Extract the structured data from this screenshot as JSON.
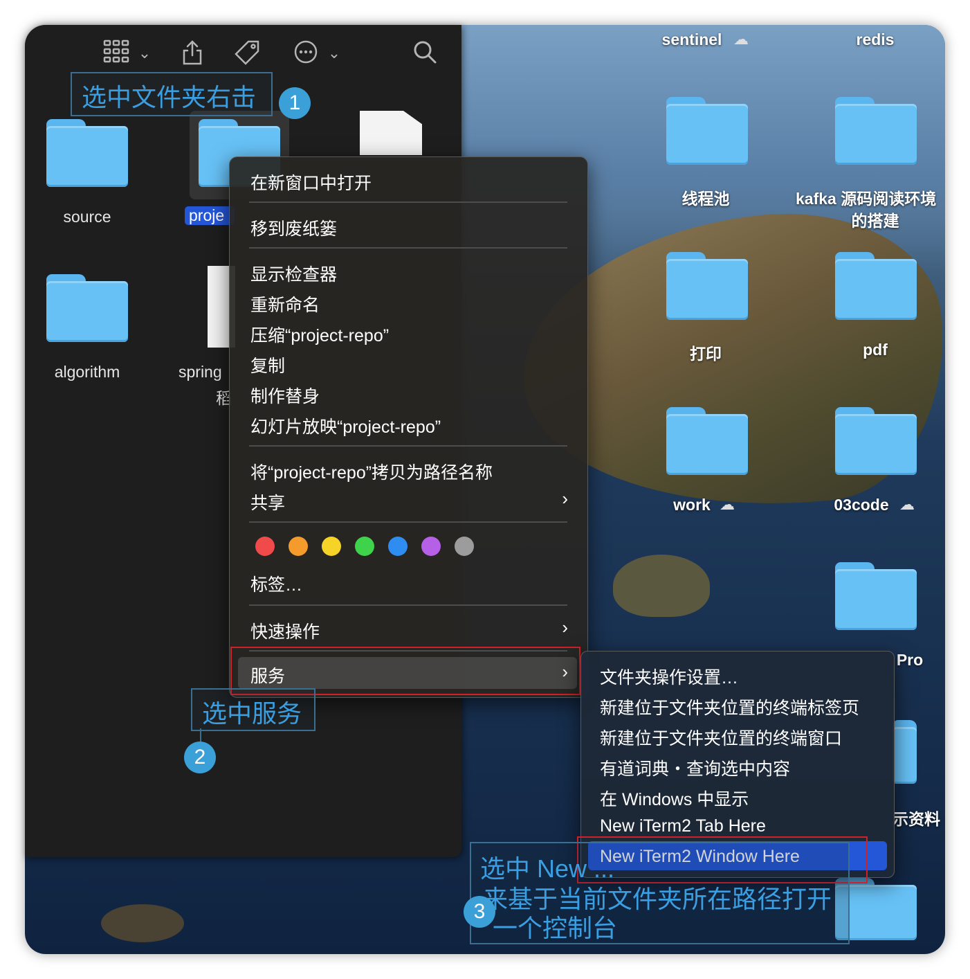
{
  "finder": {
    "toolbar_icons": [
      "grid-view-icon",
      "chevron-down-icon",
      "share-icon",
      "tag-icon",
      "more-icon",
      "chevron-down-icon",
      "search-icon"
    ],
    "items": [
      {
        "name": "source"
      },
      {
        "name": "proje"
      },
      {
        "name": "algorithm"
      },
      {
        "name": "spring"
      },
      {
        "name": "稻"
      }
    ]
  },
  "desktop": {
    "items": [
      {
        "name": "sentinel"
      },
      {
        "name": "redis"
      },
      {
        "name": "线程池"
      },
      {
        "name": "kafka 源码阅读环境"
      },
      {
        "name": "的搭建"
      },
      {
        "name": "打印"
      },
      {
        "name": "pdf"
      },
      {
        "name": "work"
      },
      {
        "name": "03code"
      },
      {
        "name": "Pro"
      },
      {
        "name": "示资料"
      }
    ]
  },
  "context_menu": {
    "open_new_window": "在新窗口中打开",
    "move_to_trash": "移到废纸篓",
    "get_info": "显示检查器",
    "rename": "重新命名",
    "compress": "压缩“project-repo”",
    "duplicate": "复制",
    "make_alias": "制作替身",
    "slideshow": "幻灯片放映“project-repo”",
    "copy_path": "将“project-repo”拷贝为路径名称",
    "share": "共享",
    "tag_colors": [
      "#f04a4a",
      "#f49b2b",
      "#f5d327",
      "#3ed34b",
      "#2f8cf0",
      "#b660e8",
      "#9c9c9c"
    ],
    "tags": "标签…",
    "quick_actions": "快速操作",
    "services": "服务"
  },
  "services_menu": {
    "items": [
      "文件夹操作设置…",
      "新建位于文件夹位置的终端标签页",
      "新建位于文件夹位置的终端窗口",
      "有道词典・查询选中内容",
      "在 Windows 中显示",
      "New iTerm2 Tab Here",
      "New iTerm2 Window Here"
    ],
    "selected_index": 6
  },
  "annotations": {
    "step1_text": "选中文件夹右击",
    "step1_num": "1",
    "step2_text": "选中服务",
    "step2_num": "2",
    "step3_line1": "选中 New ...",
    "step3_line2": "来基于当前文件夹所在路径打开",
    "step3_line3": "一个控制台",
    "step3_num": "3"
  },
  "colors": {
    "highlight": "#2456d8",
    "annotation": "#3a9ee0",
    "red_box": "#d0202a"
  }
}
